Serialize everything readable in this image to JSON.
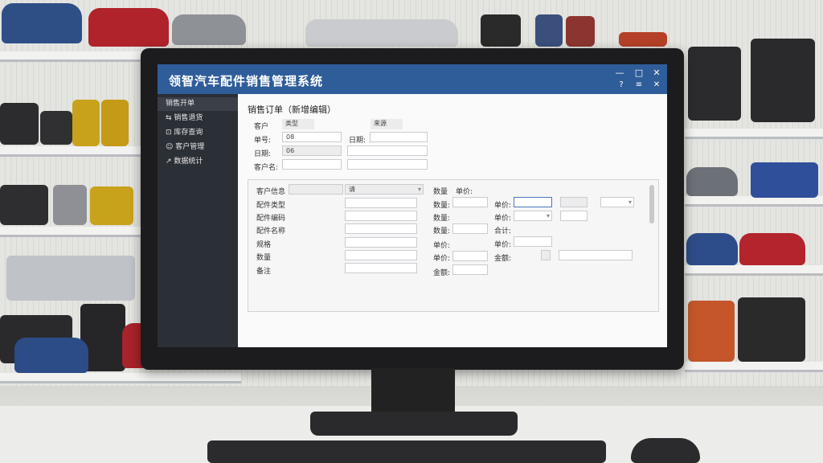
{
  "window": {
    "title": "领智汽车配件销售管理系统",
    "controls": {
      "close": "✕",
      "maximize": "□",
      "minimize": "—"
    },
    "toolbar": {
      "help": "?",
      "menu": "≡",
      "exit": "✕"
    }
  },
  "sidebar": {
    "items": [
      {
        "label": "销售开单",
        "icon": "document-icon"
      },
      {
        "label": "销售退货",
        "icon": "return-icon"
      },
      {
        "label": "库存查询",
        "icon": "box-icon"
      },
      {
        "label": "客户管理",
        "icon": "user-icon"
      },
      {
        "label": "数据统计",
        "icon": "chart-icon"
      }
    ]
  },
  "form": {
    "heading": "销售订单（新增编辑）",
    "top_labels": {
      "customer": "客户",
      "type": "类型",
      "reference": "来源"
    },
    "fields": [
      {
        "label": "单号:",
        "value": "08"
      },
      {
        "label": "日期:",
        "value": "06"
      },
      {
        "label": "客户名:",
        "value": ""
      }
    ],
    "right_fields": [
      {
        "label": "日期:",
        "value": ""
      },
      {
        "label": "",
        "value": ""
      },
      {
        "label": "",
        "value": ""
      }
    ]
  },
  "detail": {
    "left_labels": [
      "客户信息",
      "配件类型",
      "配件编码",
      "配件名称",
      "规格",
      "数量",
      "备注"
    ],
    "left_placeholder": "请",
    "mid_labels": [
      "数量",
      "数量:",
      "数量:",
      "单价:",
      "单价:",
      "金额:"
    ],
    "mid_head2": "单价:",
    "right_labels": [
      "单价:",
      "单价:",
      "合计:",
      "单价:",
      "金额:"
    ]
  },
  "colors": {
    "titlebar": "#2f5d9a",
    "sidebar": "#2b2f36",
    "accent": "#4b78c0"
  }
}
